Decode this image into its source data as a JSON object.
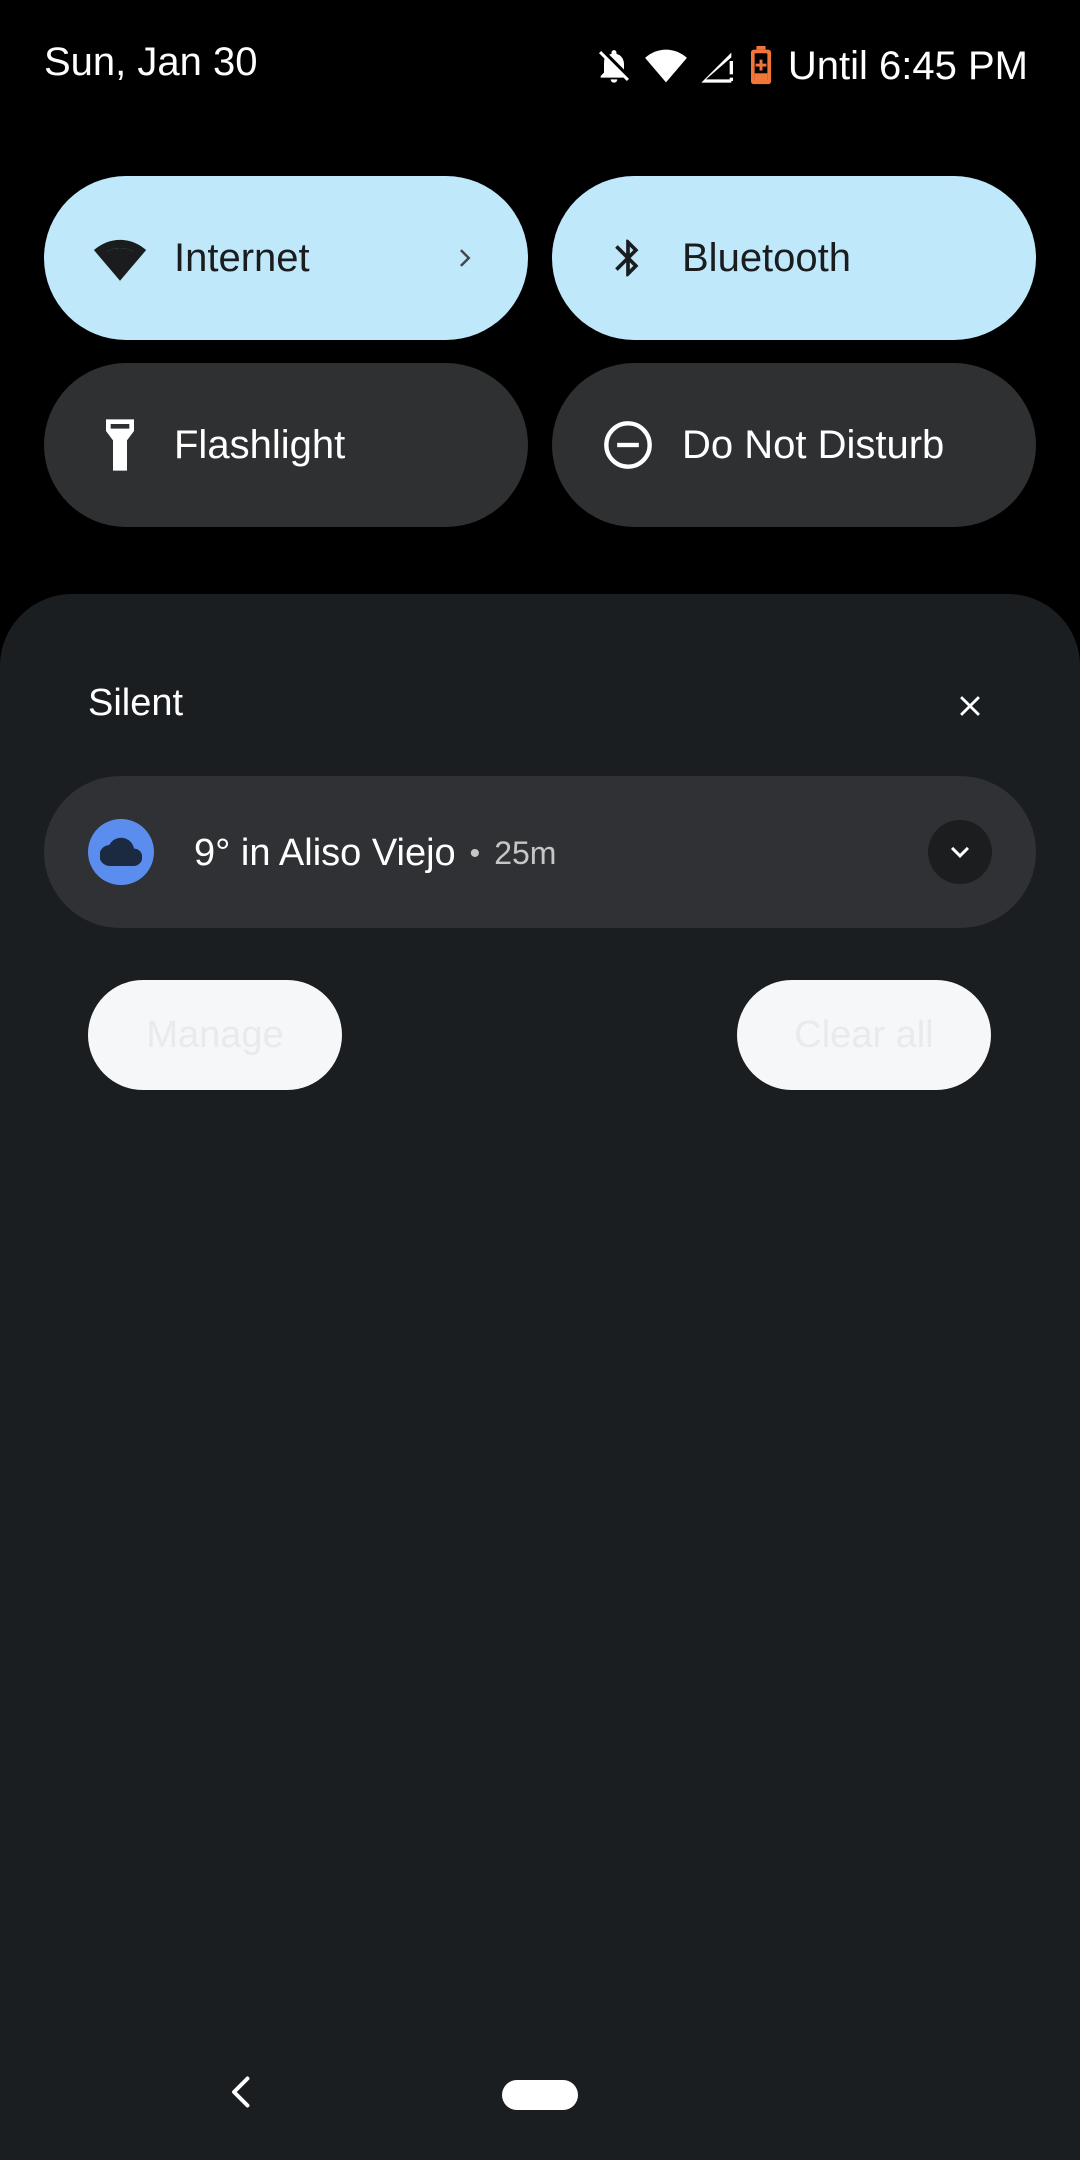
{
  "status_bar": {
    "date": "Sun, Jan 30",
    "battery_text": "Until 6:45 PM",
    "icons": [
      "bell-off-icon",
      "wifi-icon",
      "cell-signal-icon",
      "battery-saver-icon"
    ]
  },
  "quick_tiles": [
    {
      "label": "Internet",
      "icon": "wifi-icon",
      "active": true,
      "has_chevron": true
    },
    {
      "label": "Bluetooth",
      "icon": "bluetooth-icon",
      "active": true
    },
    {
      "label": "Flashlight",
      "icon": "flashlight-icon",
      "active": false
    },
    {
      "label": "Do Not Disturb",
      "icon": "do-not-disturb-icon",
      "active": false
    }
  ],
  "notifications": {
    "section_title": "Silent",
    "items": [
      {
        "title": "9° in Aliso Viejo",
        "separator": "•",
        "time": "25m",
        "icon": "cloud-icon"
      }
    ],
    "actions": {
      "manage": "Manage",
      "clear_all": "Clear all"
    }
  },
  "colors": {
    "active_tile": "#bfe8fb",
    "inactive_tile": "#2f3032",
    "shade_bg": "#1b1e21",
    "weather_icon_bg": "#5b8def",
    "battery_saver": "#f0763a"
  },
  "nav_bar": {
    "icons": [
      "back-icon",
      "home-handle"
    ]
  }
}
